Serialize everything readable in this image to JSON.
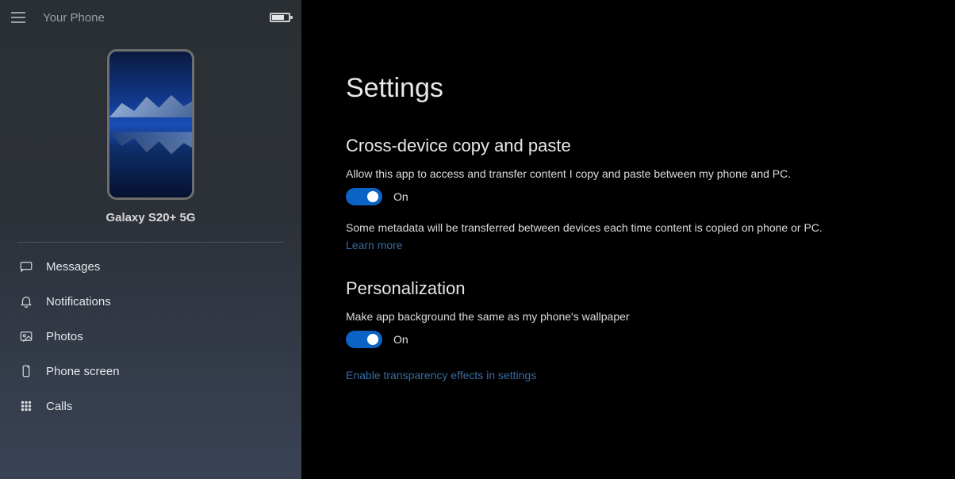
{
  "sidebar": {
    "app_title": "Your Phone",
    "device_name": "Galaxy S20+ 5G",
    "items": [
      {
        "label": "Messages"
      },
      {
        "label": "Notifications"
      },
      {
        "label": "Photos"
      },
      {
        "label": "Phone screen"
      },
      {
        "label": "Calls"
      }
    ]
  },
  "main": {
    "title": "Settings",
    "sections": {
      "clipboard": {
        "heading": "Cross-device copy and paste",
        "description": "Allow this app to access and transfer content I copy and paste between my phone and PC.",
        "toggle_state": "On",
        "note": "Some metadata will be transferred between devices each time content is copied on phone or PC.",
        "learn_more": "Learn more"
      },
      "personalization": {
        "heading": "Personalization",
        "description": "Make app background the same as my phone's wallpaper",
        "toggle_state": "On",
        "link": "Enable transparency effects in settings"
      }
    }
  }
}
